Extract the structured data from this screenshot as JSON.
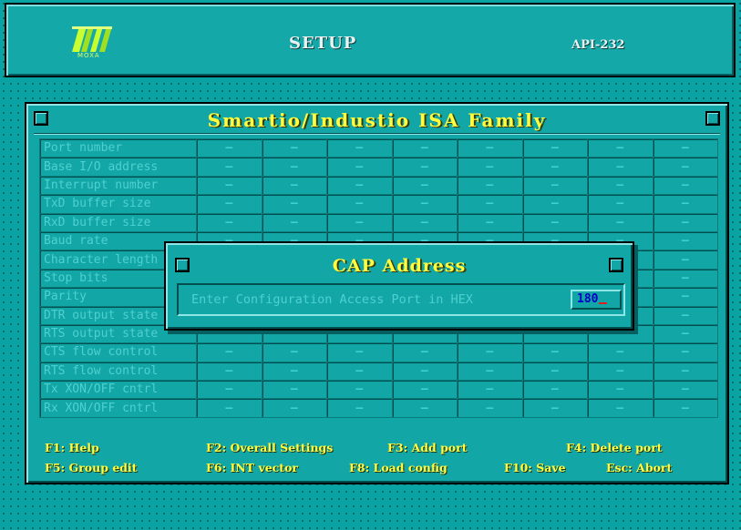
{
  "header": {
    "logo_text": "MOXA",
    "app_title": "SETUP",
    "model": "API-232"
  },
  "main_window": {
    "title": "Smartio/Industio ISA Family",
    "rows": [
      "Port number",
      "Base I/O address",
      "Interrupt number",
      "TxD buffer size",
      "RxD buffer size",
      "Baud rate",
      "Character length",
      "Stop bits",
      "Parity",
      "DTR output state",
      "RTS output state",
      "CTS flow control",
      "RTS flow control",
      "Tx XON/OFF cntrl",
      "Rx XON/OFF cntrl"
    ],
    "empty_value": "—",
    "port_column_count": 8
  },
  "function_keys": {
    "f1": "F1: Help",
    "f2": "F2: Overall Settings",
    "f3": "F3: Add port",
    "f4": "F4: Delete port",
    "f5": "F5: Group edit",
    "f6": "F6: INT vector",
    "f8": "F8: Load config",
    "f10": "F10: Save",
    "esc": "Esc: Abort"
  },
  "dialog": {
    "title": "CAP Address",
    "prompt": "Enter Configuration Access Port in HEX",
    "value": "180"
  },
  "colors": {
    "desktop": "#0aa3a3",
    "window": "#13a6a6",
    "title_text": "#ffff40",
    "label_text": "#4fd0d0",
    "input_text": "#0000c8",
    "cursor": "#e02020"
  }
}
